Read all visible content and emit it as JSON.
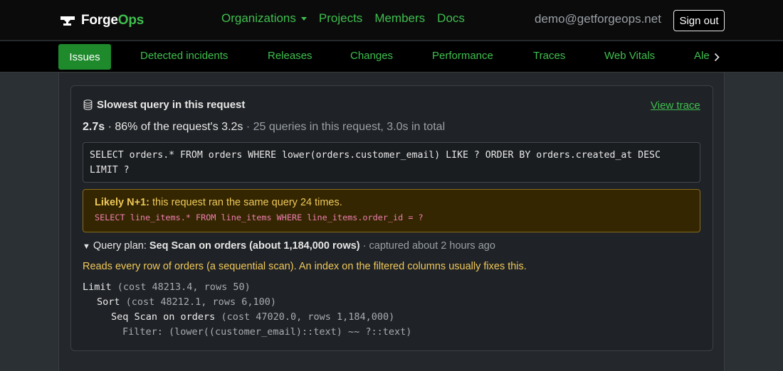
{
  "app": {
    "brand_main": "Forge",
    "brand_accent": "Ops",
    "accent_color": "#3fbf4f"
  },
  "topnav": {
    "items": [
      {
        "label": "Organizations",
        "has_dropdown": true
      },
      {
        "label": "Projects"
      },
      {
        "label": "Members"
      },
      {
        "label": "Docs"
      }
    ],
    "user_email": "demo@getforgeops.net",
    "signout_label": "Sign out"
  },
  "subnav": {
    "tabs": [
      {
        "label": "Issues",
        "active": true
      },
      {
        "label": "Detected incidents"
      },
      {
        "label": "Releases"
      },
      {
        "label": "Changes"
      },
      {
        "label": "Performance"
      },
      {
        "label": "Traces"
      },
      {
        "label": "Web Vitals"
      },
      {
        "label": "Ale"
      }
    ]
  },
  "card": {
    "title": "Slowest query in this request",
    "view_trace": "View trace",
    "summary_time": "2.7s",
    "summary_pct": " · 86% of the request's 3.2s",
    "summary_rest": " · 25 queries in this request, 3.0s in total",
    "sql_line1": "SELECT orders.* FROM orders WHERE lower(orders.customer_email) LIKE ? ORDER BY orders.created_at DESC",
    "sql_line2": "LIMIT ?",
    "warning": {
      "label": "Likely N+1:",
      "text": " this request ran the same query 24 times.",
      "sql": "SELECT line_items.* FROM line_items WHERE line_items.order_id = ?"
    },
    "plan": {
      "prefix": "Query plan: ",
      "name": "Seq Scan on orders (about 1,184,000 rows)",
      "captured": " · captured about 2 hours ago",
      "note": "Reads every row of orders (a sequential scan). An index on the filtered columns usually fixes this.",
      "rows": [
        {
          "node": "Limit",
          "meta": " (cost 48213.4, rows 50)"
        },
        {
          "node": "Sort",
          "meta": " (cost 48212.1, rows 6,100)"
        },
        {
          "node": "Seq Scan on orders",
          "meta": " (cost 47020.0, rows 1,184,000)"
        },
        {
          "node": "",
          "meta": "Filter: (lower((customer_email)::text) ~~ ?::text)"
        }
      ]
    }
  }
}
